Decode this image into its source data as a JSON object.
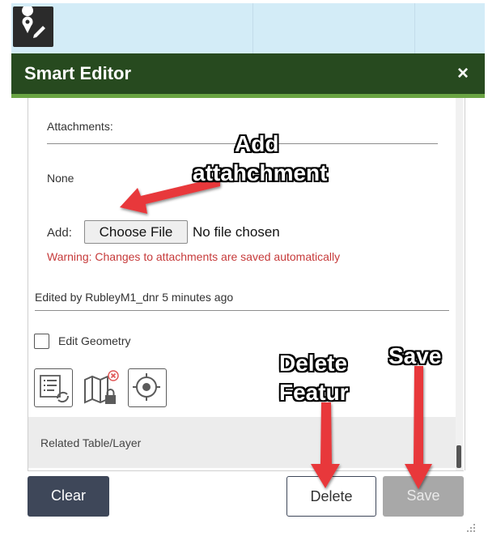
{
  "header": {
    "title": "Smart Editor",
    "close_glyph": "×"
  },
  "toolbar": {
    "tool_icon": "smart-editor-tool-icon"
  },
  "attachments": {
    "label": "Attachments:",
    "none_text": "None",
    "add_label": "Add:",
    "choose_file_label": "Choose File",
    "no_file_text": "No file chosen",
    "warning": "Warning: Changes to attachments are saved automatically"
  },
  "edited_by": "Edited by RubleyM1_dnr 5 minutes ago",
  "edit_geometry_label": "Edit Geometry",
  "icons": [
    "attribute-refresh-icon",
    "locked-map-icon",
    "locate-target-icon"
  ],
  "related_label": "Related Table/Layer",
  "buttons": {
    "clear": "Clear",
    "delete": "Delete",
    "save": "Save"
  },
  "annotations": {
    "add_attachment_line1": "Add",
    "add_attachment_line2": "attahchment",
    "delete_line1": "Delete",
    "delete_line2": "Featur",
    "save": "Save"
  },
  "colors": {
    "header": "#274a1f",
    "header_accent": "#6aa443",
    "warning": "#c63a3a",
    "arrow": "#e8373b",
    "clear_button": "#3e4759"
  }
}
